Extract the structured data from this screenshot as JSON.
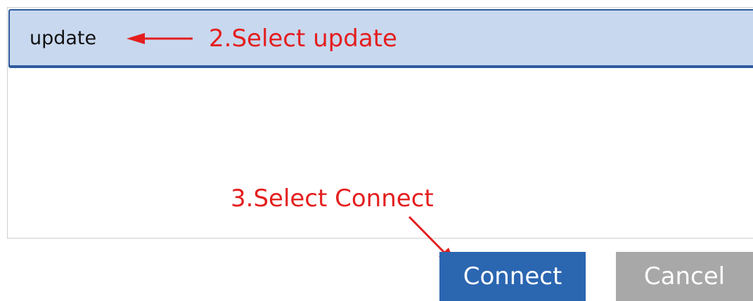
{
  "list": {
    "items": [
      {
        "label": "update",
        "selected": true
      }
    ]
  },
  "annotations": {
    "step2": "2.Select update",
    "step3": "3.Select Connect",
    "color": "#e41e1e"
  },
  "buttons": {
    "connect_label": "Connect",
    "cancel_label": "Cancel",
    "connect_color": "#2b66b1",
    "cancel_color": "#a8a8a8"
  },
  "colors": {
    "selection_fill": "#c8d8ef",
    "selection_border": "#2f5b9e"
  }
}
